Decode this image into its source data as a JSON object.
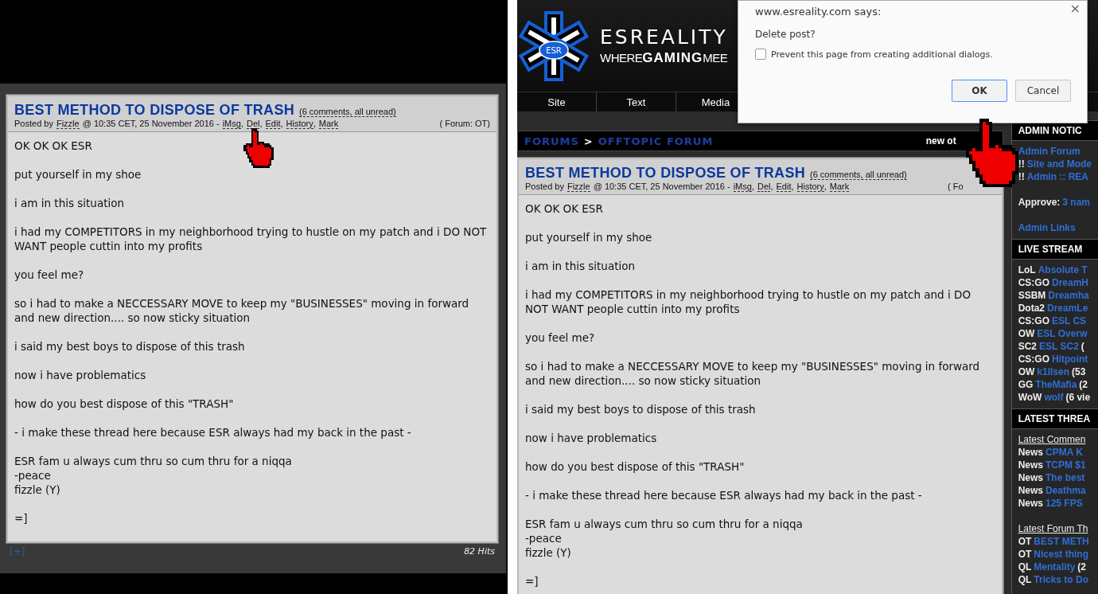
{
  "left": {
    "post": {
      "title": "BEST METHOD TO DISPOSE OF TRASH",
      "comments": "(6 comments, all unread)",
      "posted_by": "Posted by",
      "author": "Fizzle",
      "timestamp": "@ 10:35 CET, 25 November 2016 -",
      "actions": [
        "iMsg",
        "Del",
        "Edit",
        "History",
        "Mark"
      ],
      "separator": ",",
      "forum": "( Forum: OT)",
      "paragraphs": [
        [
          "OK OK OK ESR"
        ],
        [
          "put yourself in my shoe"
        ],
        [
          "i am in this situation"
        ],
        [
          "i had my COMPETITORS in my neighborhood trying to hustle on my patch and i DO NOT WANT people cuttin into my profits"
        ],
        [
          "you feel me?"
        ],
        [
          "so i had to make a NECCESSARY MOVE to keep my \"BUSINESSES\" moving in forward and new direction.... so now sticky situation"
        ],
        [
          "i said my best boys to dispose of this trash"
        ],
        [
          "now i have problematics"
        ],
        [
          "how do you best dispose of this \"TRASH\""
        ],
        [
          "- i make these thread here because ESR always had my back in the past -"
        ],
        [
          "ESR fam u always cum thru so cum thru for a niqqa",
          "-peace",
          "fizzle (Y)"
        ],
        [
          "=]"
        ]
      ]
    },
    "expand": "[+]",
    "hits": "82 Hits"
  },
  "right": {
    "logo": {
      "badge": "ESR",
      "wordmark": "ESREALITY",
      "tagline": [
        "WHERE",
        "GAMING",
        "MEE"
      ]
    },
    "nav": [
      {
        "label": "Site"
      },
      {
        "label": "Text"
      },
      {
        "label": "Media"
      }
    ],
    "breadcrumb": {
      "parts": [
        "FORUMS",
        ">",
        "OFFTOPIC FORUM"
      ],
      "right": "new ot"
    },
    "post": {
      "title": "BEST METHOD TO DISPOSE OF TRASH",
      "comments": "(6 comments, all unread)",
      "posted_by": "Posted by",
      "author": "Fizzle",
      "timestamp": "@ 10:35 CET, 25 November 2016 -",
      "actions": [
        "iMsg",
        "Del",
        "Edit",
        "History",
        "Mark"
      ],
      "separator": ",",
      "forum": "( Fo",
      "paragraphs": [
        [
          "OK OK OK ESR"
        ],
        [
          "put yourself in my shoe"
        ],
        [
          "i am in this situation"
        ],
        [
          "i had my COMPETITORS in my neighborhood trying to hustle on my patch and i DO NOT WANT people cuttin into my profits"
        ],
        [
          "you feel me?"
        ],
        [
          "so i had to make a NECCESSARY MOVE to keep my \"BUSINESSES\" moving in forward and new direction.... so now sticky situation"
        ],
        [
          "i said my best boys to dispose of this trash"
        ],
        [
          "now i have problematics"
        ],
        [
          "how do you best dispose of this \"TRASH\""
        ],
        [
          "- i make these thread here because ESR always had my back in the past -"
        ],
        [
          "ESR fam u always cum thru so cum thru for a niqqa",
          "-peace",
          "fizzle (Y)"
        ],
        [
          "=]"
        ]
      ]
    },
    "sidebar": [
      {
        "heading": "ADMIN NOTIC",
        "items": [
          {
            "kind": "link",
            "link": "Admin Forum"
          },
          {
            "kind": "pair",
            "label": "!!",
            "link": "Site and Mode"
          },
          {
            "kind": "pair",
            "label": "!!",
            "link": "Admin :: REA"
          },
          {
            "kind": "gap"
          },
          {
            "kind": "pair",
            "label": "Approve:",
            "link": "3 nam"
          },
          {
            "kind": "gap"
          },
          {
            "kind": "link",
            "link": "Admin Links"
          }
        ]
      },
      {
        "heading": "LIVE STREAM",
        "items": [
          {
            "kind": "pair",
            "label": "LoL",
            "link": "Absolute T"
          },
          {
            "kind": "pair",
            "label": "CS:GO",
            "link": "DreamH"
          },
          {
            "kind": "pair",
            "label": "SSBM",
            "link": "Dreamha"
          },
          {
            "kind": "pair",
            "label": "Dota2",
            "link": "DreamLe"
          },
          {
            "kind": "pair",
            "label": "CS:GO",
            "link": "ESL CS"
          },
          {
            "kind": "pair",
            "label": "OW",
            "link": "ESL Overw"
          },
          {
            "kind": "pair",
            "label": "SC2",
            "link": "ESL SC2",
            "suffix": "("
          },
          {
            "kind": "pair",
            "label": "CS:GO",
            "link": "Hitpoint"
          },
          {
            "kind": "pair",
            "label": "OW",
            "link": "k1llsen",
            "suffix": "(53"
          },
          {
            "kind": "pair",
            "label": "GG",
            "link": "TheMafia",
            "suffix": "(2"
          },
          {
            "kind": "pair",
            "label": "WoW",
            "link": "wolf",
            "suffix": "(6 vie"
          }
        ]
      },
      {
        "heading": "LATEST THREA",
        "items": [
          {
            "kind": "subhead",
            "text": "Latest Commen"
          },
          {
            "kind": "pair",
            "label": "News",
            "link": "CPMA K"
          },
          {
            "kind": "pair",
            "label": "News",
            "link": "TCPM $1"
          },
          {
            "kind": "pair",
            "label": "News",
            "link": "The best"
          },
          {
            "kind": "pair",
            "label": "News",
            "link": "Deathma"
          },
          {
            "kind": "pair",
            "label": "News",
            "link": "125 FPS"
          },
          {
            "kind": "gap"
          },
          {
            "kind": "subhead",
            "text": "Latest Forum Th"
          },
          {
            "kind": "pair",
            "label": "OT",
            "link": "BEST METH"
          },
          {
            "kind": "pair",
            "label": "OT",
            "link": "Nicest thing"
          },
          {
            "kind": "pair",
            "label": "QL",
            "link": "Mentality",
            "suffix": "(2"
          },
          {
            "kind": "pair",
            "label": "QL",
            "link": "Tricks to Do"
          }
        ]
      }
    ]
  },
  "dialog": {
    "title": "www.esreality.com says:",
    "close": "×",
    "message": "Delete post?",
    "checkbox": {
      "label": "Prevent this page from creating additional dialogs.",
      "checked": false
    },
    "buttons": [
      {
        "label": "OK",
        "focused": true
      },
      {
        "label": "Cancel",
        "focused": false
      }
    ]
  }
}
